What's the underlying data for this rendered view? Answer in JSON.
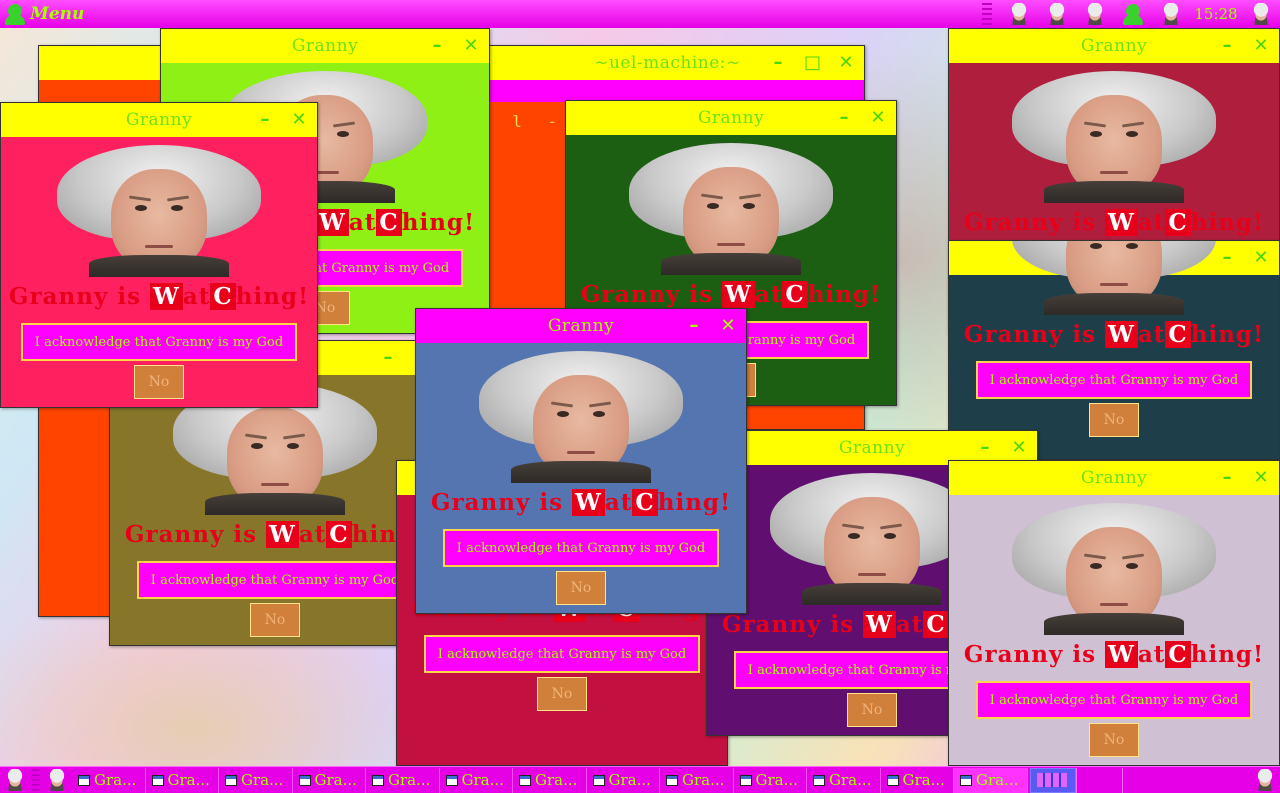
{
  "panel": {
    "menu_label": "Menu",
    "clock": "15:28",
    "tray_icons": [
      "granny-face-icon",
      "granny-face-icon",
      "granny-face-icon",
      "user-head-icon",
      "granny-face-icon"
    ]
  },
  "popup": {
    "title": "Granny",
    "slogan_pre": "Granny is ",
    "slogan_block": "W",
    "slogan_mid": "at",
    "slogan_block2": "C",
    "slogan_post": "hing!",
    "ack_label": "I acknowledge that Granny is my God",
    "no_label": "No"
  },
  "terminal": {
    "title": "~uel-machine:~",
    "text": "e l -"
  },
  "windows": [
    {
      "bg": "#ff4400",
      "title_bg": "#ffff00"
    },
    {
      "bg": "#8ff016",
      "title_bg": "#ffff00"
    },
    {
      "bg": "#1d5f12",
      "title_bg": "#ffff00"
    },
    {
      "bg": "#af1f3d",
      "title_bg": "#ffff00"
    },
    {
      "bg": "#1e3f4a",
      "title_bg": "#ffff00"
    },
    {
      "bg": "#877629",
      "title_bg": "#ffff00"
    },
    {
      "bg": "#ff2060",
      "title_bg": "#ffff00"
    },
    {
      "bg": "#c21040",
      "title_bg": "#ffff00"
    },
    {
      "bg": "#600f70",
      "title_bg": "#ffff00"
    },
    {
      "bg": "#cfc0d4",
      "title_bg": "#ffff00"
    },
    {
      "bg": "#5575b0",
      "title_bg": "#ff00ff"
    }
  ],
  "taskbar": {
    "task_label": "Gra...",
    "task_count": 13,
    "active_task_index": 12,
    "pager_active": 0
  }
}
